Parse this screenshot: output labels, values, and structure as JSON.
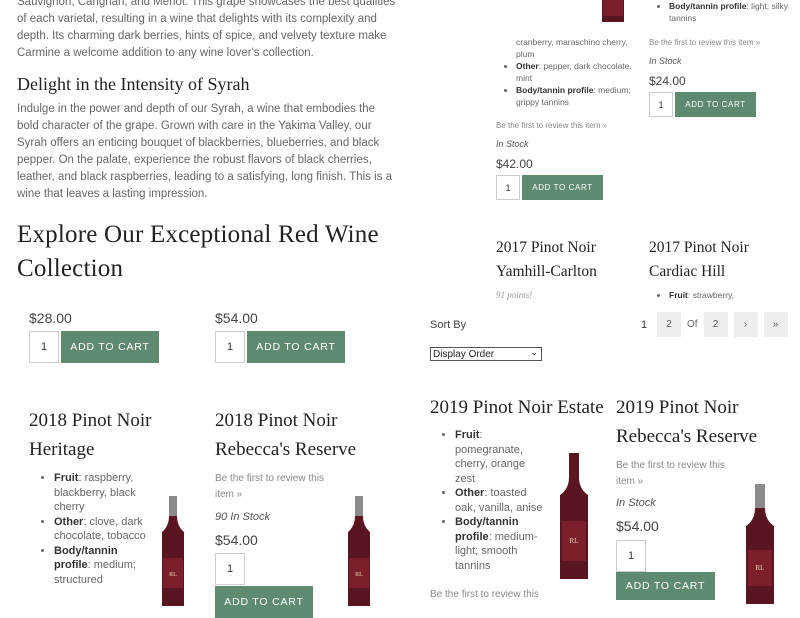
{
  "intro": {
    "lines": [
      "Sauvignon, Carignan, and Merlot. This grape showcases the best qualities",
      "of each varietal, resulting in a wine that delights with its complexity and",
      "depth. Its charming dark berries, hints of spice, and velvety texture make",
      "Carmine a welcome addition to any wine lover's collection."
    ]
  },
  "syrah": {
    "heading": "Delight in the Intensity of Syrah",
    "lines": [
      "Indulge in the power and depth of our Syrah, a wine that embodies the",
      "bold character of the grape. Grown with care in the Yakima Valley, our",
      "Syrah offers an enticing bouquet of blackberries, blueberries, and black",
      "pepper. On the palate, experience the robust flavors of black cherries,",
      "leather, and black raspberries, leading to a satisfying, long finish. This is a",
      "wine that leaves a lasting impression."
    ]
  },
  "collection": {
    "heading_line1": "Explore Our Exceptional Red Wine",
    "heading_line2": "Collection"
  },
  "left_top": [
    {
      "price": "$28.00",
      "qty": "1",
      "button": "Add to cart"
    },
    {
      "price": "$54.00",
      "qty": "1",
      "button": "Add to cart"
    }
  ],
  "left_products": [
    {
      "name_line1": "2018 Pinot Noir",
      "name_line2": "Heritage",
      "attrs": [
        {
          "label": "Fruit",
          "text": ": raspberry, blackberry, black cherry"
        },
        {
          "label": "Other",
          "text": ": clove, dark chocolate, tobacco"
        },
        {
          "label": "Body/tannin profile",
          "text": ": medium; structured"
        }
      ]
    },
    {
      "name_line1": "2018 Pinot Noir",
      "name_line2": "Rebecca's Reserve",
      "review": "Be the first to review this item »",
      "stock": "90 In Stock",
      "price": "$54.00",
      "qty": "1",
      "button": "Add to cart"
    }
  ],
  "right_top": {
    "col1_attrs_tail": "cranberry, maraschino cherry, plum",
    "col1_other": {
      "label": "Other",
      "text": ": pepper, dark chocolate, mint"
    },
    "col1_body": {
      "label": "Body/tannin profile",
      "text": ": medium; grippy tannins"
    },
    "col1_review": "Be the first to review this item »",
    "col1_stock": "In Stock",
    "col1_price": "$42.00",
    "col1_qty": "1",
    "col1_button": "Add to cart",
    "col2_body": {
      "label": "Body/tannin profile",
      "text": ": light; silky tannins"
    },
    "col2_review": "Be the first to review this item »",
    "col2_stock": "In Stock",
    "col2_price": "$24.00",
    "col2_qty": "1",
    "col2_button": "Add to cart",
    "p3_name_line1": "2017 Pinot Noir",
    "p3_name_line2": "Yamhill-Carlton",
    "p3_points": "91 points!",
    "p4_name_line1": "2017 Pinot Noir",
    "p4_name_line2": "Cardiac Hill",
    "p4_fruit": {
      "label": "Fruit",
      "text": ": strawberry,"
    }
  },
  "sort": {
    "label": "Sort By",
    "selected": "Display Order"
  },
  "pagination": {
    "current": "1",
    "next_page": "2",
    "of": "Of",
    "total": "2",
    "next": "›",
    "last": "»"
  },
  "right_products": [
    {
      "name": "2019 Pinot Noir Estate",
      "attrs": [
        {
          "label": "Fruit",
          "text": ": pomegranate, cherry, orange zest"
        },
        {
          "label": "Other",
          "text": ": toasted oak, vanilla, anise"
        },
        {
          "label": "Body/tannin profile",
          "text": ": medium-light; smooth tannins"
        }
      ],
      "review": "Be the first to review this"
    },
    {
      "name_line1": "2019 Pinot Noir",
      "name_line2": "Rebecca's Reserve",
      "review": "Be the first to review this item »",
      "stock": "In Stock",
      "price": "$54.00",
      "qty": "1",
      "button": "Add to cart"
    }
  ],
  "colors": {
    "button": "#5e8a6f",
    "wine": "#7a1f2b"
  }
}
